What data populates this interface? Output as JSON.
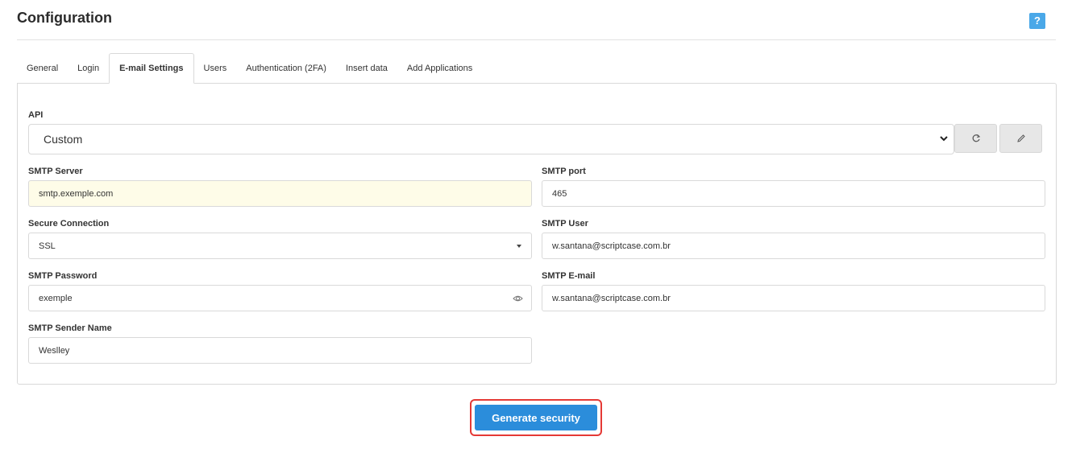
{
  "header": {
    "title": "Configuration",
    "help_label": "?"
  },
  "tabs": [
    {
      "label": "General",
      "active": false
    },
    {
      "label": "Login",
      "active": false
    },
    {
      "label": "E-mail Settings",
      "active": true
    },
    {
      "label": "Users",
      "active": false
    },
    {
      "label": "Authentication (2FA)",
      "active": false
    },
    {
      "label": "Insert data",
      "active": false
    },
    {
      "label": "Add Applications",
      "active": false
    }
  ],
  "form": {
    "api": {
      "label": "API",
      "value": "Custom"
    },
    "smtp_server": {
      "label": "SMTP Server",
      "value": "smtp.exemple.com"
    },
    "smtp_port": {
      "label": "SMTP port",
      "value": "465"
    },
    "secure_connection": {
      "label": "Secure Connection",
      "value": "SSL"
    },
    "smtp_user": {
      "label": "SMTP User",
      "value": "w.santana@scriptcase.com.br"
    },
    "smtp_password": {
      "label": "SMTP Password",
      "value": "exemple"
    },
    "smtp_email": {
      "label": "SMTP E-mail",
      "value": "w.santana@scriptcase.com.br"
    },
    "smtp_sender_name": {
      "label": "SMTP Sender Name",
      "value": "Weslley"
    }
  },
  "actions": {
    "generate_label": "Generate security"
  },
  "icons": {
    "help": "help-icon",
    "refresh": "refresh-icon",
    "edit": "pencil-icon",
    "chevron": "chevron-down-icon",
    "caret": "caret-down-icon",
    "eye": "eye-icon"
  },
  "colors": {
    "accent": "#2b8ddb",
    "help": "#4aa8e8",
    "highlight_border": "#e53935",
    "autofill_bg": "#fefce8"
  }
}
